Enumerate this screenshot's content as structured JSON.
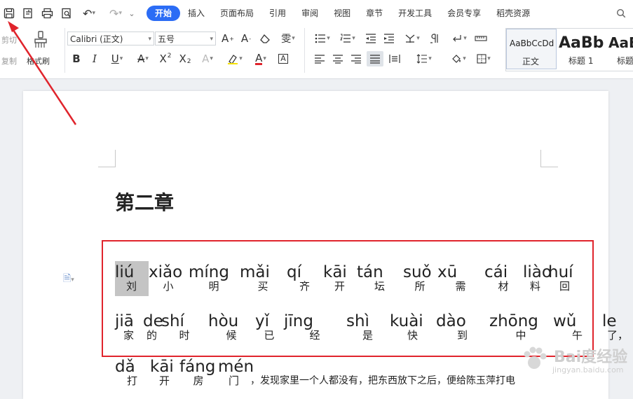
{
  "tabs": [
    {
      "label": "开始",
      "active": true
    },
    {
      "label": "插入"
    },
    {
      "label": "页面布局"
    },
    {
      "label": "引用"
    },
    {
      "label": "审阅"
    },
    {
      "label": "视图"
    },
    {
      "label": "章节"
    },
    {
      "label": "开发工具"
    },
    {
      "label": "会员专享"
    },
    {
      "label": "稻壳资源"
    }
  ],
  "quick_access": {
    "save_icon": "save-icon",
    "undo_glyph": "↶",
    "redo_glyph": "↷",
    "save_glyph": "🖫",
    "print_glyph": "⎙"
  },
  "clipboard": {
    "cut": "剪切",
    "copy": "复制",
    "format_painter": "格式刷"
  },
  "font": {
    "name": "Calibri (正文)",
    "size": "五号"
  },
  "styles": [
    {
      "sample": "AaBbCcDd",
      "name": "正文"
    },
    {
      "sample": "AaBb",
      "name": "标题 1"
    },
    {
      "sample": "AaB",
      "name": "标题"
    }
  ],
  "doc": {
    "heading": "第二章",
    "line1": [
      {
        "py": "liú",
        "hz": "刘"
      },
      {
        "py": "xiǎo",
        "hz": "小"
      },
      {
        "py": "míng",
        "hz": "明"
      },
      {
        "py": "mǎi",
        "hz": "买"
      },
      {
        "py": "qí",
        "hz": "齐"
      },
      {
        "py": "kāi",
        "hz": "开"
      },
      {
        "py": "tán",
        "hz": "坛"
      },
      {
        "py": "suǒ",
        "hz": "所"
      },
      {
        "py": "xū",
        "hz": "需"
      },
      {
        "py": "cái",
        "hz": "材"
      },
      {
        "py": "liào",
        "hz": "料"
      },
      {
        "py": "huí",
        "hz": "回"
      }
    ],
    "line2": [
      {
        "py": "jiā",
        "hz": "家"
      },
      {
        "py": "de",
        "hz": "的"
      },
      {
        "py": "shí",
        "hz": "时"
      },
      {
        "py": "hòu",
        "hz": "候"
      },
      {
        "py": "yǐ",
        "hz": "已"
      },
      {
        "py": "jīng",
        "hz": "经"
      },
      {
        "py": "shì",
        "hz": "是"
      },
      {
        "py": "kuài",
        "hz": "快"
      },
      {
        "py": "dào",
        "hz": "到"
      },
      {
        "py": "zhōng",
        "hz": "中"
      },
      {
        "py": "wǔ",
        "hz": "午"
      },
      {
        "py": "le",
        "hz": "了，"
      }
    ],
    "line3": [
      {
        "py": "dǎ",
        "hz": "打"
      },
      {
        "py": "kāi",
        "hz": "开"
      },
      {
        "py": "fáng",
        "hz": "房"
      },
      {
        "py": "mén",
        "hz": "门"
      }
    ],
    "line3_tail": "，发现家里一个人都没有，把东西放下之后，便给陈玉萍打电"
  },
  "watermark": {
    "text": "Bai度经验",
    "sub": "jingyan.baidu.com"
  },
  "colors": {
    "accent": "#2b6cf5",
    "annotation": "#e0242c"
  }
}
